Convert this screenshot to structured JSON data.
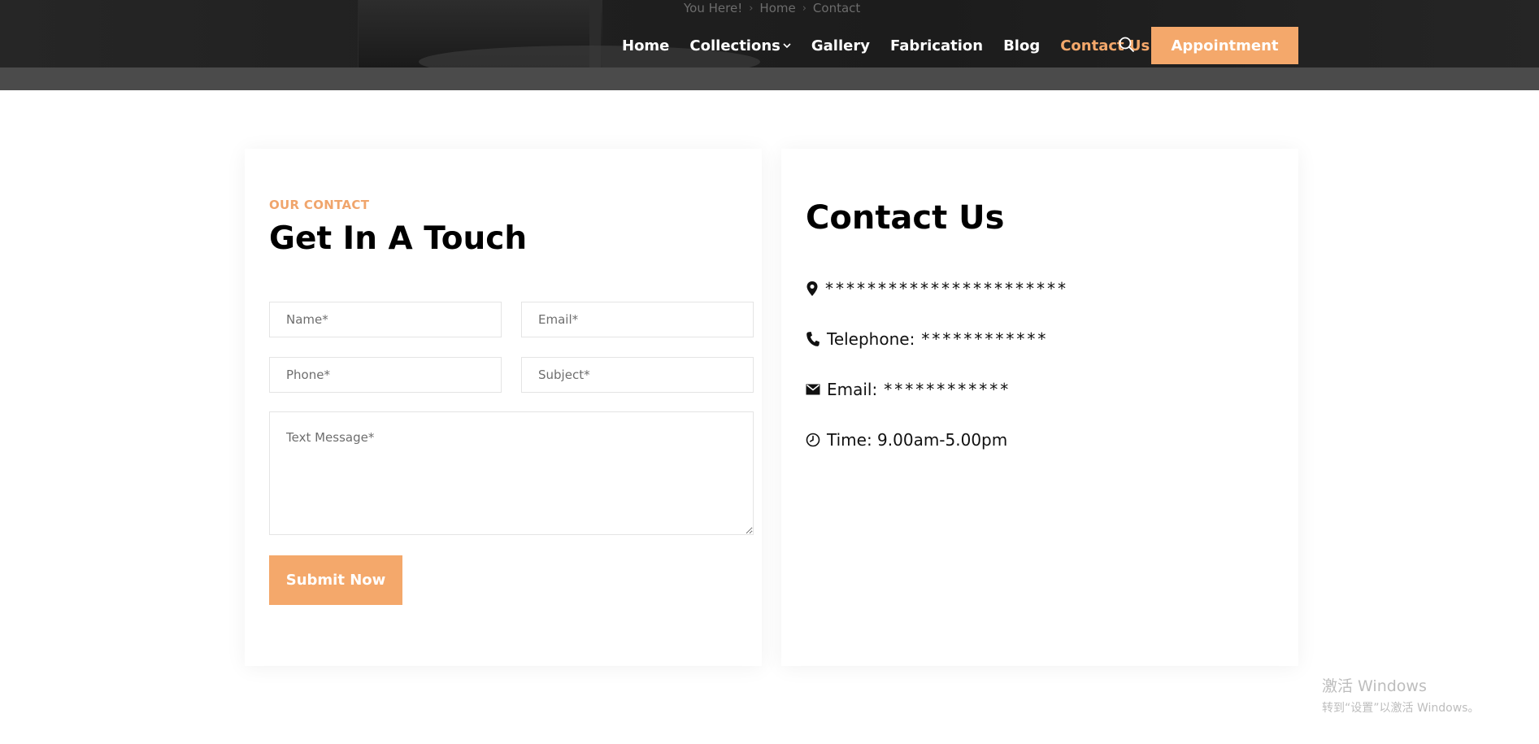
{
  "header": {
    "breadcrumb": {
      "prefix": "You Here!",
      "items": [
        "Home",
        "Contact"
      ]
    },
    "nav": [
      {
        "label": "Home",
        "has_dropdown": false,
        "active": false
      },
      {
        "label": "Collections",
        "has_dropdown": true,
        "active": false
      },
      {
        "label": "Gallery",
        "has_dropdown": false,
        "active": false
      },
      {
        "label": "Fabrication",
        "has_dropdown": false,
        "active": false
      },
      {
        "label": "Blog",
        "has_dropdown": false,
        "active": false
      },
      {
        "label": "Contact Us",
        "has_dropdown": true,
        "active": true
      }
    ],
    "search_icon": "search-icon",
    "appointment_label": "Appointment"
  },
  "form_card": {
    "eyebrow": "OUR CONTACT",
    "title": "Get In A Touch",
    "fields": {
      "name_placeholder": "Name*",
      "email_placeholder": "Email*",
      "phone_placeholder": "Phone*",
      "subject_placeholder": "Subject*",
      "message_placeholder": "Text Message*"
    },
    "submit_label": "Submit Now"
  },
  "contact_card": {
    "title": "Contact Us",
    "address": "***********************",
    "telephone_label": "Telephone:",
    "telephone_value": "************",
    "email_label": "Email:",
    "email_value": "************",
    "time": "Time: 9.00am-5.00pm"
  },
  "watermark": {
    "line1": "激活 Windows",
    "line2": "转到“设置”以激活 Windows。"
  },
  "colors": {
    "accent": "#f4a86b",
    "header_bg": "#202020",
    "header_strip": "#4b4b4b"
  }
}
